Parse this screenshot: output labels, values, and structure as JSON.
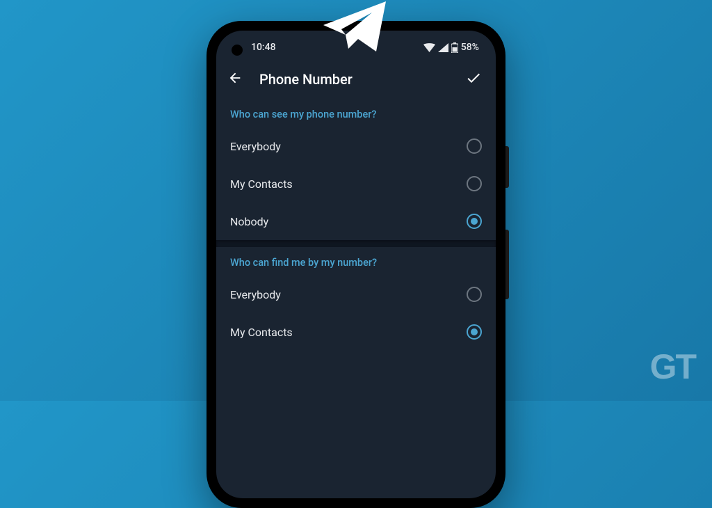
{
  "statusBar": {
    "time": "10:48",
    "battery": "58%"
  },
  "header": {
    "title": "Phone Number"
  },
  "sections": {
    "visibility": {
      "header": "Who can see my phone number?",
      "options": {
        "everybody": "Everybody",
        "myContacts": "My Contacts",
        "nobody": "Nobody"
      },
      "selected": "nobody"
    },
    "findability": {
      "header": "Who can find me by my number?",
      "options": {
        "everybody": "Everybody",
        "myContacts": "My Contacts"
      },
      "selected": "myContacts"
    }
  },
  "watermark": "GT"
}
